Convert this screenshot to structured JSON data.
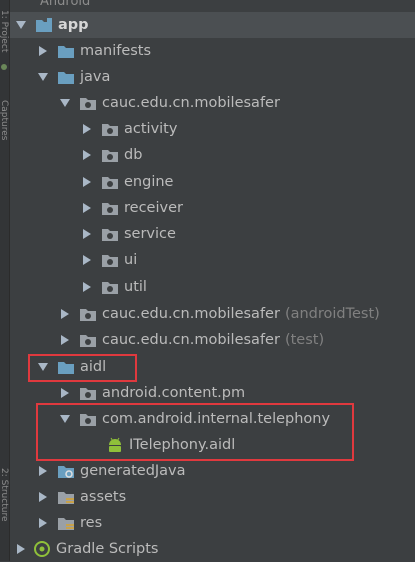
{
  "top_tab": "Android",
  "side_tabs": {
    "upper": "1: Project",
    "middle": "Captures",
    "lower": "2: Structure"
  },
  "tree": {
    "app": "app",
    "manifests": "manifests",
    "java": "java",
    "pkg_main": "cauc.edu.cn.mobilesafer",
    "activity": "activity",
    "db": "db",
    "engine": "engine",
    "receiver": "receiver",
    "service": "service",
    "ui": "ui",
    "util": "util",
    "pkg_android_test": "cauc.edu.cn.mobilesafer",
    "pkg_android_test_suffix": "(androidTest)",
    "pkg_test": "cauc.edu.cn.mobilesafer",
    "pkg_test_suffix": "(test)",
    "aidl": "aidl",
    "android_content_pm": "android.content.pm",
    "com_android_internal_telephony": "com.android.internal.telephony",
    "itelephony": "ITelephony.aidl",
    "generated_java": "generatedJava",
    "assets": "assets",
    "res": "res",
    "gradle_scripts": "Gradle Scripts"
  },
  "colors": {
    "background": "#3c3f41",
    "text": "#bbbbbb",
    "folder_blue": "#6a9fc0",
    "package_gray": "#9aa0a6",
    "highlight_red": "#e0393e",
    "android_green": "#8fc03a"
  }
}
